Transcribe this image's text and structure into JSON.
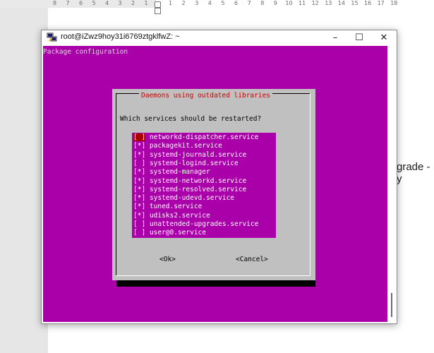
{
  "ruler": {
    "left_numbers": [
      "8",
      "7",
      "6",
      "5",
      "4",
      "3",
      "2",
      "1"
    ],
    "right_numbers": [
      "1",
      "2",
      "3",
      "4",
      "5",
      "6",
      "7",
      "8",
      "9",
      "10",
      "11",
      "12",
      "13",
      "14",
      "15",
      "16",
      "17",
      "18"
    ]
  },
  "document": {
    "visible_text": "grade -y"
  },
  "window": {
    "title": "root@iZwz9hoy31i6769ztgklfwZ: ~",
    "minimize_glyph": "–",
    "maximize_glyph": "☐",
    "close_glyph": "✕"
  },
  "terminal": {
    "header": "Package configuration",
    "background_color": "#aa00aa",
    "dialog": {
      "title": "Daemons using outdated libraries",
      "title_color": "#cc0000",
      "prompt": "Which services should be restarted?",
      "items": [
        {
          "mark": "[ ]",
          "name": "networkd-dispatcher.service"
        },
        {
          "mark": "[*]",
          "name": "packagekit.service"
        },
        {
          "mark": "[*]",
          "name": "systemd-journald.service"
        },
        {
          "mark": "[ ]",
          "name": "systemd-logind.service"
        },
        {
          "mark": "[*]",
          "name": "systemd-manager"
        },
        {
          "mark": "[*]",
          "name": "systemd-networkd.service"
        },
        {
          "mark": "[*]",
          "name": "systemd-resolved.service"
        },
        {
          "mark": "[*]",
          "name": "systemd-udevd.service"
        },
        {
          "mark": "[*]",
          "name": "tuned.service"
        },
        {
          "mark": "[*]",
          "name": "udisks2.service"
        },
        {
          "mark": "[ ]",
          "name": "unattended-upgrades.service"
        },
        {
          "mark": "[ ]",
          "name": "user@0.service"
        }
      ],
      "ok_label": "<Ok>",
      "cancel_label": "<Cancel>"
    }
  }
}
